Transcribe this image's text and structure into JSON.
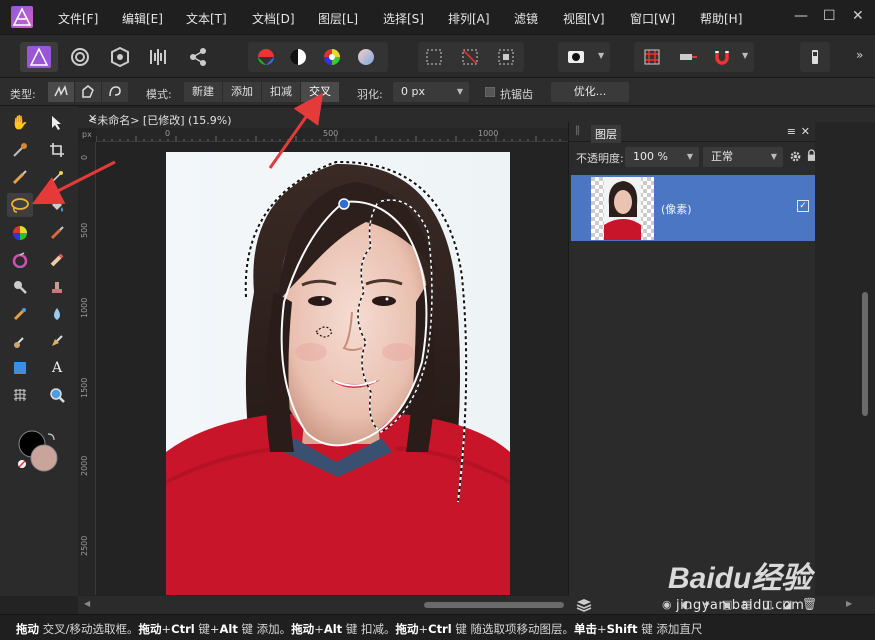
{
  "menu": [
    "文件[F]",
    "编辑[E]",
    "文本[T]",
    "文档[D]",
    "图层[L]",
    "选择[S]",
    "排列[A]",
    "滤镜",
    "视图[V]",
    "窗口[W]",
    "帮助[H]"
  ],
  "window_controls": [
    "—",
    "☐",
    "✕"
  ],
  "context": {
    "type_label": "类型:",
    "mode_label": "模式:",
    "modes": [
      "新建",
      "添加",
      "扣减",
      "交叉"
    ],
    "active_mode": "交叉",
    "feather_label": "羽化:",
    "feather_value": "0 px",
    "antialias_label": "抗锯齿",
    "refine_button": "优化..."
  },
  "document": {
    "tab_title": "<未命名> [已修改] (15.9%)",
    "close": "✕"
  },
  "ruler": {
    "unit": "px",
    "h_labels": [
      "0",
      "500",
      "1000",
      "1500",
      "2000"
    ],
    "v_labels": [
      "0",
      "500",
      "1000",
      "1500",
      "2000",
      "2500"
    ]
  },
  "layers_panel": {
    "title": "图层",
    "opacity_label": "不透明度:",
    "opacity_value": "100 %",
    "blend_mode": "正常",
    "layer_name": "(像素)",
    "menu_icon": "≡",
    "close_icon": "✕"
  },
  "status": {
    "parts": [
      {
        "b": "拖动",
        "t": " 交叉/移动选取框。"
      },
      {
        "b": "拖动",
        "t": "+"
      },
      {
        "b": "Ctrl",
        "t": " 键+"
      },
      {
        "b": "Alt",
        "t": " 键 添加。"
      },
      {
        "b": "拖动",
        "t": "+"
      },
      {
        "b": "Alt",
        "t": " 键 扣减。"
      },
      {
        "b": "拖动",
        "t": "+"
      },
      {
        "b": "Ctrl",
        "t": " 键 随选取项移动图层。"
      },
      {
        "b": "单击",
        "t": "+"
      },
      {
        "b": "Shift",
        "t": " 键 添加直尺"
      }
    ]
  },
  "watermark": {
    "brand": "Baidu经验",
    "url": "jingyan.baidu.com"
  },
  "colors": {
    "accent": "#4a76c4",
    "arrow": "#e53a3a",
    "sweater": "#c8152a",
    "secondary_swatch": "#c9a49b"
  }
}
